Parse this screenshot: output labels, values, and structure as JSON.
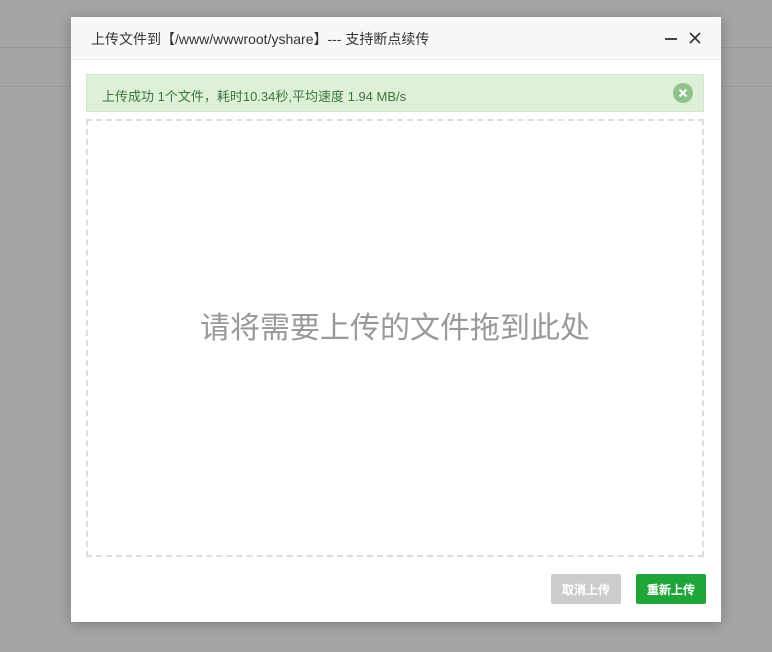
{
  "dialog": {
    "title": "上传文件到【/www/wwwroot/yshare】--- 支持断点续传",
    "minimize_icon": "minimize-icon",
    "close_icon": "close-icon"
  },
  "alert": {
    "message": "上传成功 1个文件，耗时10.34秒,平均速度 1.94 MB/s",
    "close_icon": "circle-x-icon",
    "color": "#3c763d",
    "background": "#dff0d8"
  },
  "dropzone": {
    "hint": "请将需要上传的文件拖到此处"
  },
  "buttons": {
    "cancel_label": "取消上传",
    "reupload_label": "重新上传",
    "accent": "#20a53a"
  }
}
